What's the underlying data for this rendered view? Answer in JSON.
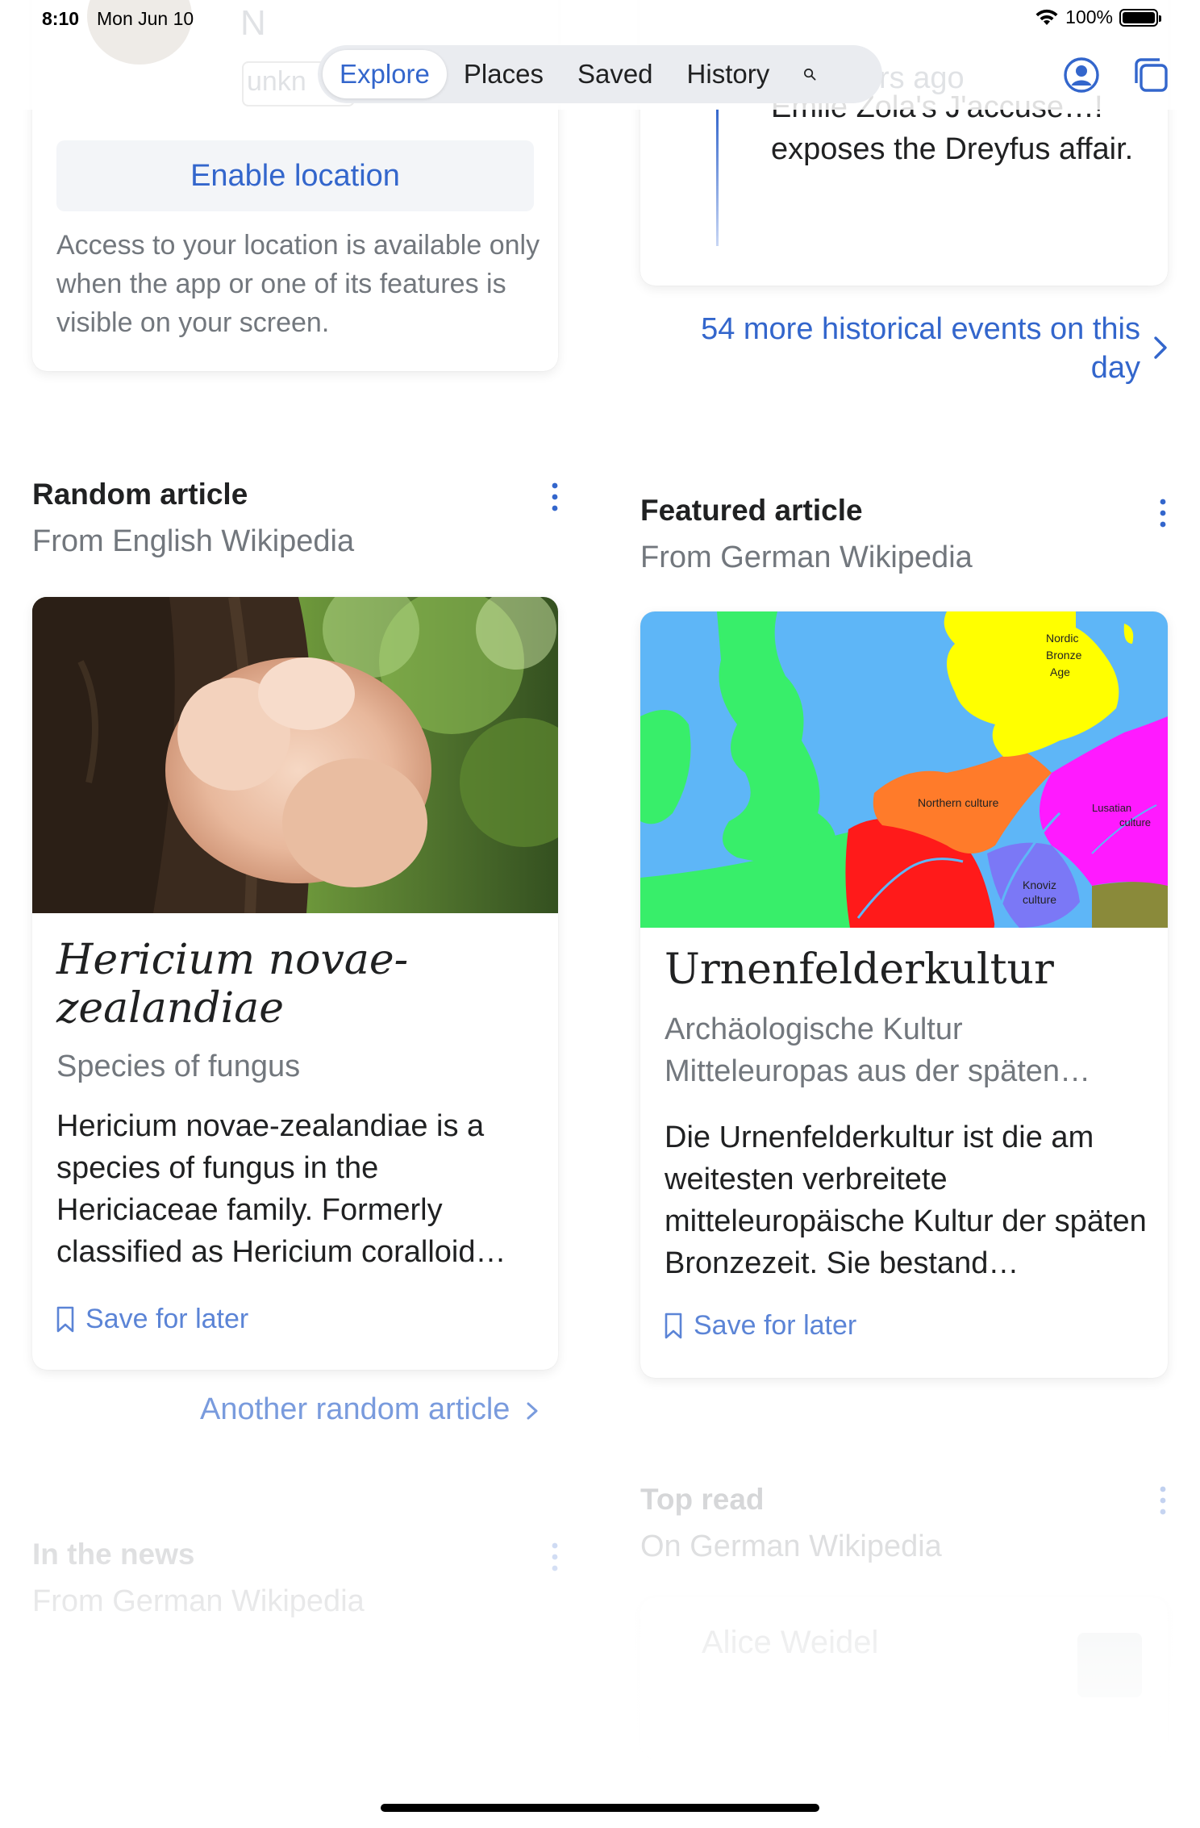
{
  "status_bar": {
    "time": "8:10",
    "date": "Mon Jun 10",
    "battery": "100%"
  },
  "nav": {
    "tabs": [
      "Explore",
      "Places",
      "Saved",
      "History"
    ],
    "active_tab": "Explore",
    "ghost_text": {
      "n": "N",
      "unkn": "unkn",
      "ago": "rs ago"
    }
  },
  "location_card": {
    "button_label": "Enable location",
    "description": "Access to your location is available only when the app or one of its features is visible on your screen."
  },
  "on_this_day": {
    "event_text": "Émile Zola's J'accuse…! exposes the Dreyfus affair.",
    "more_link": "54 more historical events on this day"
  },
  "random_article": {
    "section_title": "Random article",
    "section_subtitle": "From English Wikipedia",
    "title": "Hericium novae-zealandiae",
    "description": "Species of fungus",
    "extract": "Hericium novae-zealandiae is a species of fungus in the Hericiaceae family. Formerly classified as Hericium coralloid…",
    "save_label": "Save for later",
    "another_link": "Another random article"
  },
  "featured_article": {
    "section_title": "Featured article",
    "section_subtitle": "From German Wikipedia",
    "title": "Urnenfelderkultur",
    "description": "Archäologische Kultur Mitteleuropas aus der späten…",
    "extract": "Die Urnenfelderkultur ist die am weitesten verbreitete mitteleuropäische Kultur der späten Bronzezeit. Sie bestand…",
    "save_label": "Save for later",
    "map_labels": {
      "nordic_1": "Nordic",
      "nordic_2": "Bronze",
      "nordic_3": "Age",
      "northern": "Northern culture",
      "lusatian_1": "Lusatian",
      "lusatian_2": "culture",
      "knoviz_1": "Knoviz",
      "knoviz_2": "culture"
    }
  },
  "in_the_news": {
    "section_title": "In the news",
    "section_subtitle": "From German Wikipedia"
  },
  "top_read": {
    "section_title": "Top read",
    "section_subtitle": "On German Wikipedia",
    "first_item": "Alice Weidel"
  },
  "colors": {
    "accent": "#3366cc",
    "secondary_text": "#72777d",
    "primary_text": "#202122"
  }
}
